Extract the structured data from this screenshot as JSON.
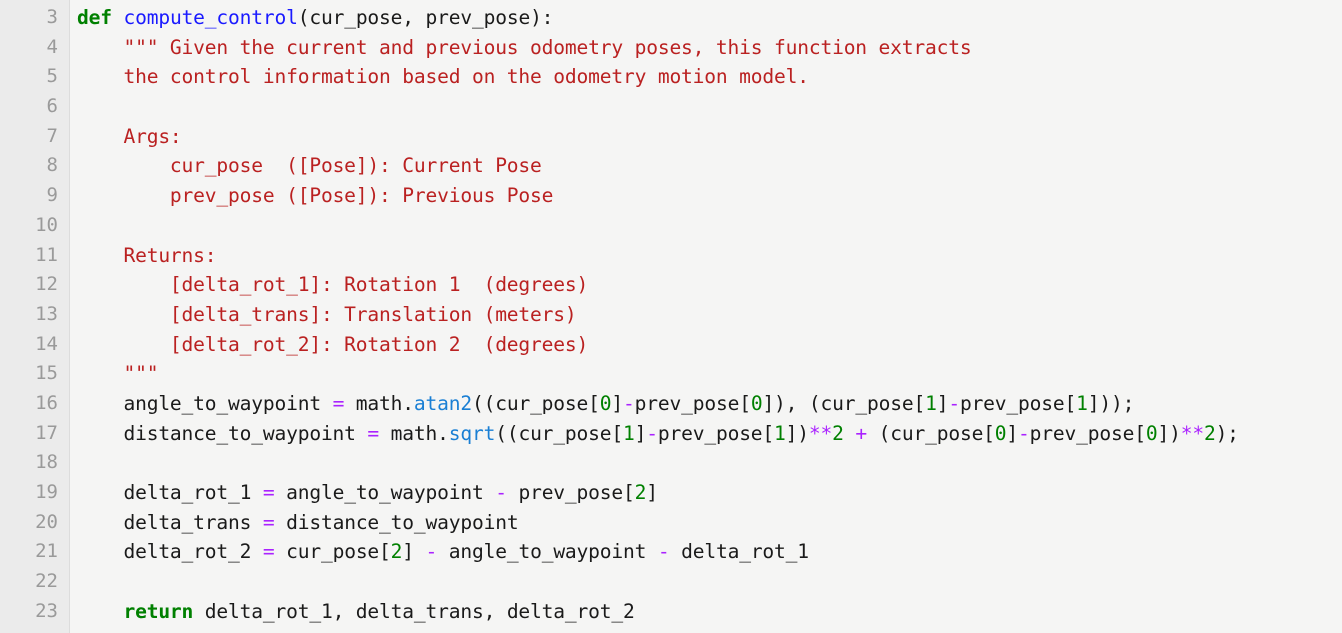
{
  "editor": {
    "language": "python",
    "colors": {
      "background": "#f5f5f4",
      "gutter_background": "#ebebeb",
      "gutter_border": "#dcdcdc",
      "line_number": "#9a9a9a",
      "keyword": "#008000",
      "function_name": "#1a1aff",
      "builtin": "#1a7fd4",
      "string": "#ba2121",
      "number": "#008000",
      "operator": "#aa22ff",
      "plain_text": "#1a1a1a"
    },
    "first_line_number": 3,
    "last_line_number": 23,
    "line_numbers": [
      3,
      4,
      5,
      6,
      7,
      8,
      9,
      10,
      11,
      12,
      13,
      14,
      15,
      16,
      17,
      18,
      19,
      20,
      21,
      22,
      23
    ],
    "lines": [
      {
        "number": 3,
        "text": "def compute_control(cur_pose, prev_pose):",
        "tokens": [
          {
            "t": "def",
            "c": "kw"
          },
          {
            "t": " ",
            "c": "plain"
          },
          {
            "t": "compute_control",
            "c": "fn"
          },
          {
            "t": "(cur_pose, prev_pose):",
            "c": "plain"
          }
        ]
      },
      {
        "number": 4,
        "text": "    \"\"\" Given the current and previous odometry poses, this function extracts",
        "tokens": [
          {
            "t": "    ",
            "c": "plain"
          },
          {
            "t": "\"\"\" Given the current and previous odometry poses, this function extracts",
            "c": "str"
          }
        ]
      },
      {
        "number": 5,
        "text": "    the control information based on the odometry motion model.",
        "tokens": [
          {
            "t": "    ",
            "c": "plain"
          },
          {
            "t": "the control information based on the odometry motion model.",
            "c": "str"
          }
        ]
      },
      {
        "number": 6,
        "text": "",
        "tokens": []
      },
      {
        "number": 7,
        "text": "    Args:",
        "tokens": [
          {
            "t": "    ",
            "c": "plain"
          },
          {
            "t": "Args:",
            "c": "str"
          }
        ]
      },
      {
        "number": 8,
        "text": "        cur_pose  ([Pose]): Current Pose",
        "tokens": [
          {
            "t": "    ",
            "c": "plain"
          },
          {
            "t": "    cur_pose  ([Pose]): Current Pose",
            "c": "str"
          }
        ]
      },
      {
        "number": 9,
        "text": "        prev_pose ([Pose]): Previous Pose",
        "tokens": [
          {
            "t": "    ",
            "c": "plain"
          },
          {
            "t": "    prev_pose ([Pose]): Previous Pose",
            "c": "str"
          }
        ]
      },
      {
        "number": 10,
        "text": "",
        "tokens": []
      },
      {
        "number": 11,
        "text": "    Returns:",
        "tokens": [
          {
            "t": "    ",
            "c": "plain"
          },
          {
            "t": "Returns:",
            "c": "str"
          }
        ]
      },
      {
        "number": 12,
        "text": "        [delta_rot_1]: Rotation 1  (degrees)",
        "tokens": [
          {
            "t": "    ",
            "c": "plain"
          },
          {
            "t": "    [delta_rot_1]: Rotation 1  (degrees)",
            "c": "str"
          }
        ]
      },
      {
        "number": 13,
        "text": "        [delta_trans]: Translation (meters)",
        "tokens": [
          {
            "t": "    ",
            "c": "plain"
          },
          {
            "t": "    [delta_trans]: Translation (meters)",
            "c": "str"
          }
        ]
      },
      {
        "number": 14,
        "text": "        [delta_rot_2]: Rotation 2  (degrees)",
        "tokens": [
          {
            "t": "    ",
            "c": "plain"
          },
          {
            "t": "    [delta_rot_2]: Rotation 2  (degrees)",
            "c": "str"
          }
        ]
      },
      {
        "number": 15,
        "text": "    \"\"\"",
        "tokens": [
          {
            "t": "    ",
            "c": "plain"
          },
          {
            "t": "\"\"\"",
            "c": "str"
          }
        ]
      },
      {
        "number": 16,
        "text": "    angle_to_waypoint = math.atan2((cur_pose[0]-prev_pose[0]), (cur_pose[1]-prev_pose[1]));",
        "tokens": [
          {
            "t": "    angle_to_waypoint ",
            "c": "plain"
          },
          {
            "t": "=",
            "c": "op"
          },
          {
            "t": " math.",
            "c": "plain"
          },
          {
            "t": "atan2",
            "c": "builtin"
          },
          {
            "t": "((cur_pose[",
            "c": "plain"
          },
          {
            "t": "0",
            "c": "num"
          },
          {
            "t": "]",
            "c": "plain"
          },
          {
            "t": "-",
            "c": "op"
          },
          {
            "t": "prev_pose[",
            "c": "plain"
          },
          {
            "t": "0",
            "c": "num"
          },
          {
            "t": "]), (cur_pose[",
            "c": "plain"
          },
          {
            "t": "1",
            "c": "num"
          },
          {
            "t": "]",
            "c": "plain"
          },
          {
            "t": "-",
            "c": "op"
          },
          {
            "t": "prev_pose[",
            "c": "plain"
          },
          {
            "t": "1",
            "c": "num"
          },
          {
            "t": "]));",
            "c": "plain"
          }
        ]
      },
      {
        "number": 17,
        "text": "    distance_to_waypoint = math.sqrt((cur_pose[1]-prev_pose[1])**2 + (cur_pose[0]-prev_pose[0])**2);",
        "tokens": [
          {
            "t": "    distance_to_waypoint ",
            "c": "plain"
          },
          {
            "t": "=",
            "c": "op"
          },
          {
            "t": " math.",
            "c": "plain"
          },
          {
            "t": "sqrt",
            "c": "builtin"
          },
          {
            "t": "((cur_pose[",
            "c": "plain"
          },
          {
            "t": "1",
            "c": "num"
          },
          {
            "t": "]",
            "c": "plain"
          },
          {
            "t": "-",
            "c": "op"
          },
          {
            "t": "prev_pose[",
            "c": "plain"
          },
          {
            "t": "1",
            "c": "num"
          },
          {
            "t": "])",
            "c": "plain"
          },
          {
            "t": "**",
            "c": "op"
          },
          {
            "t": "2",
            "c": "num"
          },
          {
            "t": " ",
            "c": "plain"
          },
          {
            "t": "+",
            "c": "op"
          },
          {
            "t": " (cur_pose[",
            "c": "plain"
          },
          {
            "t": "0",
            "c": "num"
          },
          {
            "t": "]",
            "c": "plain"
          },
          {
            "t": "-",
            "c": "op"
          },
          {
            "t": "prev_pose[",
            "c": "plain"
          },
          {
            "t": "0",
            "c": "num"
          },
          {
            "t": "])",
            "c": "plain"
          },
          {
            "t": "**",
            "c": "op"
          },
          {
            "t": "2",
            "c": "num"
          },
          {
            "t": ");",
            "c": "plain"
          }
        ]
      },
      {
        "number": 18,
        "text": "",
        "tokens": []
      },
      {
        "number": 19,
        "text": "    delta_rot_1 = angle_to_waypoint - prev_pose[2]",
        "tokens": [
          {
            "t": "    delta_rot_1 ",
            "c": "plain"
          },
          {
            "t": "=",
            "c": "op"
          },
          {
            "t": " angle_to_waypoint ",
            "c": "plain"
          },
          {
            "t": "-",
            "c": "op"
          },
          {
            "t": " prev_pose[",
            "c": "plain"
          },
          {
            "t": "2",
            "c": "num"
          },
          {
            "t": "]",
            "c": "plain"
          }
        ]
      },
      {
        "number": 20,
        "text": "    delta_trans = distance_to_waypoint",
        "tokens": [
          {
            "t": "    delta_trans ",
            "c": "plain"
          },
          {
            "t": "=",
            "c": "op"
          },
          {
            "t": " distance_to_waypoint",
            "c": "plain"
          }
        ]
      },
      {
        "number": 21,
        "text": "    delta_rot_2 = cur_pose[2] - angle_to_waypoint - delta_rot_1",
        "tokens": [
          {
            "t": "    delta_rot_2 ",
            "c": "plain"
          },
          {
            "t": "=",
            "c": "op"
          },
          {
            "t": " cur_pose[",
            "c": "plain"
          },
          {
            "t": "2",
            "c": "num"
          },
          {
            "t": "] ",
            "c": "plain"
          },
          {
            "t": "-",
            "c": "op"
          },
          {
            "t": " angle_to_waypoint ",
            "c": "plain"
          },
          {
            "t": "-",
            "c": "op"
          },
          {
            "t": " delta_rot_1",
            "c": "plain"
          }
        ]
      },
      {
        "number": 22,
        "text": "",
        "tokens": []
      },
      {
        "number": 23,
        "text": "    return delta_rot_1, delta_trans, delta_rot_2",
        "tokens": [
          {
            "t": "    ",
            "c": "plain"
          },
          {
            "t": "return",
            "c": "kw"
          },
          {
            "t": " delta_rot_1, delta_trans, delta_rot_2",
            "c": "plain"
          }
        ]
      }
    ]
  }
}
